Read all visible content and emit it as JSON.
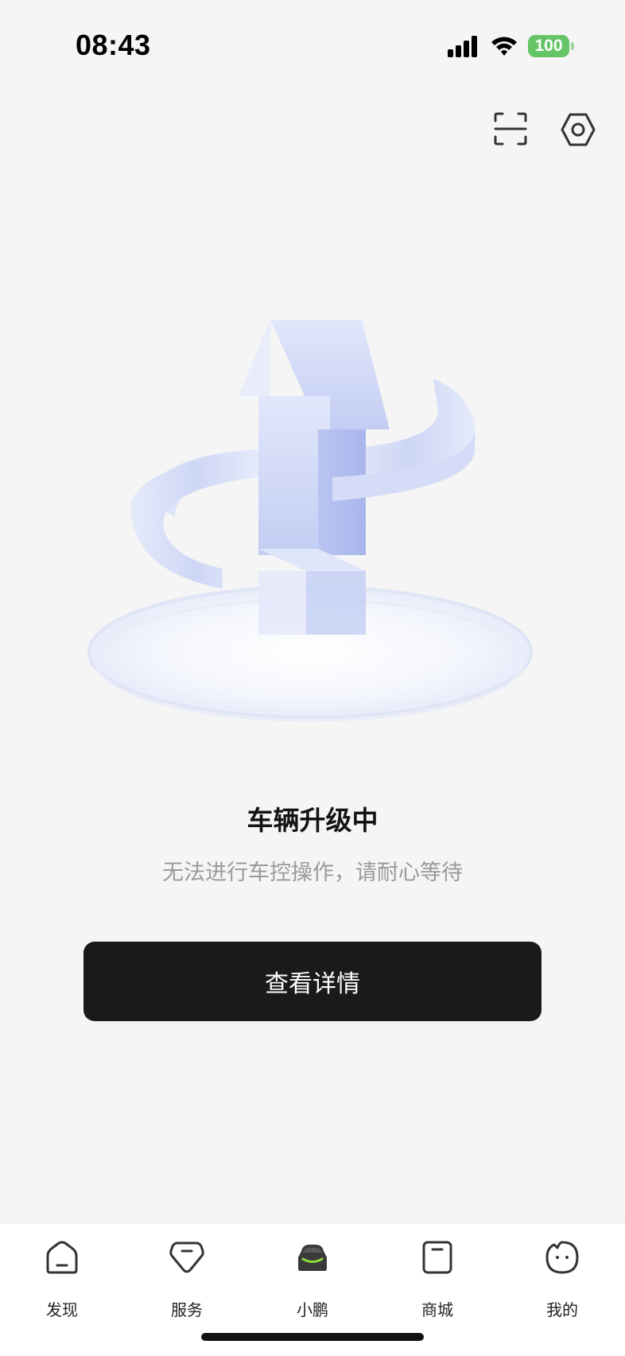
{
  "status_bar": {
    "time": "08:43",
    "battery": "100"
  },
  "top_actions": {
    "scan_icon": "scan-icon",
    "settings_icon": "hexagon-gear-icon"
  },
  "content": {
    "title": "车辆升级中",
    "subtitle": "无法进行车控操作，请耐心等待",
    "button_label": "查看详情"
  },
  "tabs": [
    {
      "label": "发现",
      "icon": "discover-icon",
      "active": false
    },
    {
      "label": "服务",
      "icon": "service-icon",
      "active": false
    },
    {
      "label": "小鹏",
      "icon": "car-icon",
      "active": true
    },
    {
      "label": "商城",
      "icon": "mall-icon",
      "active": false
    },
    {
      "label": "我的",
      "icon": "profile-icon",
      "active": false
    }
  ],
  "colors": {
    "accent_green": "#8fdc3c",
    "battery_green": "#65c466",
    "button_bg": "#1a1a1a",
    "illustration_blue": "#bcc8f2"
  }
}
